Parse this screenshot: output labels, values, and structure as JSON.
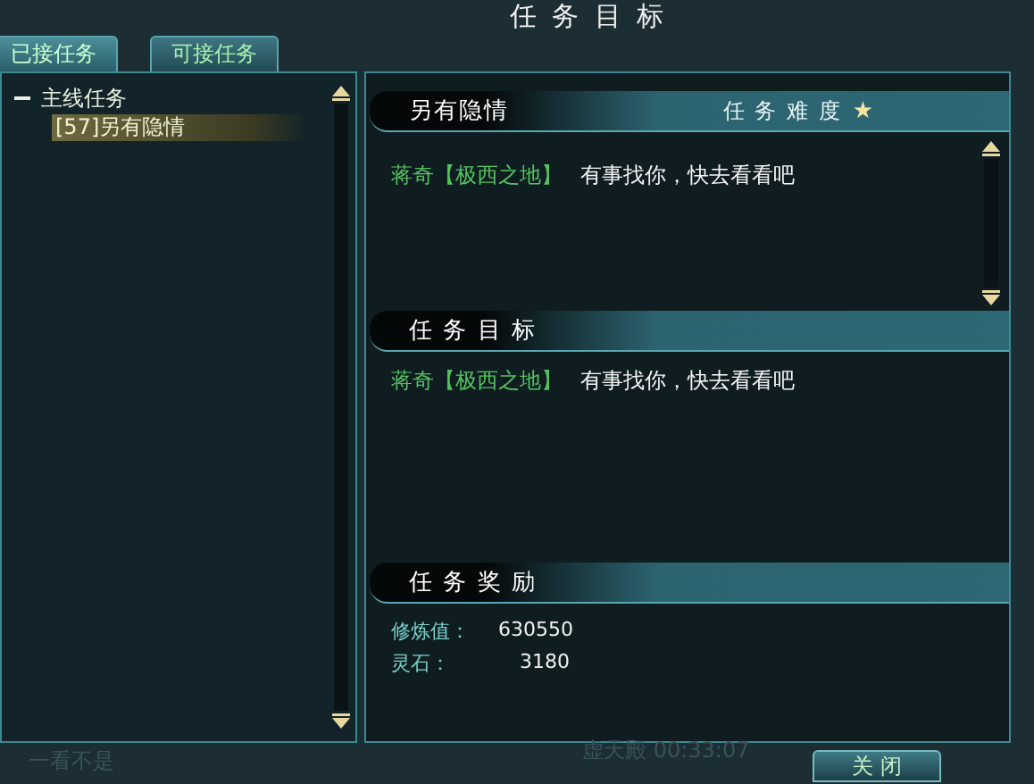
{
  "window": {
    "title": "任 务 目 标"
  },
  "tabs": [
    {
      "label": "已接任务",
      "selected": true
    },
    {
      "label": "可接任务",
      "selected": false
    }
  ],
  "quest_tree": [
    {
      "label": "主线任务",
      "expanded": true,
      "children": [
        {
          "label": "[57]另有隐情",
          "selected": true
        }
      ]
    }
  ],
  "quest": {
    "name": "另有隐情",
    "difficulty_label": "任 务 难 度",
    "difficulty_mark": "★",
    "description": {
      "npc": "蒋奇【极西之地】",
      "text": "有事找你，快去看看吧"
    }
  },
  "objective": {
    "heading": "任 务 目 标",
    "npc": "蒋奇【极西之地】",
    "text": "有事找你，快去看看吧"
  },
  "rewards": {
    "heading": "任 务 奖 励",
    "items": [
      {
        "label": "修炼值：",
        "value": "630550"
      },
      {
        "label": "灵石：",
        "value": "3180"
      }
    ]
  },
  "background_texts": [
    "一看不是",
    "虚天殿 00:33:07"
  ],
  "buttons": [
    "关 闭"
  ]
}
